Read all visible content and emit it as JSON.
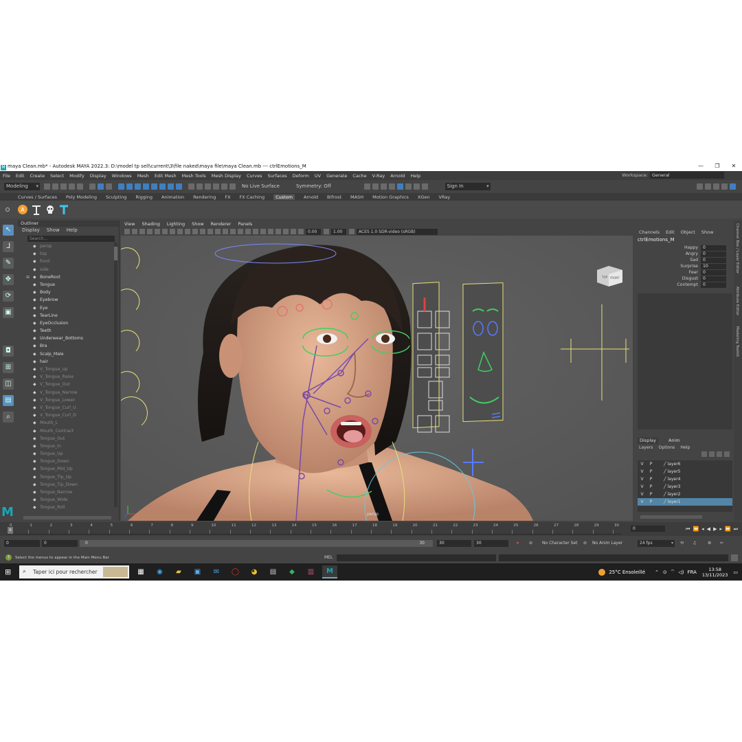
{
  "window": {
    "title": "maya Clean.mb* - Autodesk MAYA 2022.3: D:\\model tp sell\\current\\3\\file naked\\maya file\\maya Clean.mb  ---  ctrlEmotions_M",
    "logo_letter": "M",
    "minimize": "—",
    "maximize": "❐",
    "close": "✕"
  },
  "menubar": {
    "items": [
      "File",
      "Edit",
      "Create",
      "Select",
      "Modify",
      "Display",
      "Windows",
      "Mesh",
      "Edit Mesh",
      "Mesh Tools",
      "Mesh Display",
      "Curves",
      "Surfaces",
      "Deform",
      "UV",
      "Generate",
      "Cache",
      "V-Ray",
      "Arnold",
      "Help"
    ],
    "workspace_label": "Workspace:",
    "workspace_value": "General"
  },
  "statusline": {
    "mode": "Modeling",
    "live_surface": "No Live Surface",
    "symmetry": "Symmetry: Off",
    "sign_in": "Sign In"
  },
  "shelf": {
    "tabs": [
      "Curves / Surfaces",
      "Poly Modeling",
      "Sculpting",
      "Rigging",
      "Animation",
      "Rendering",
      "FX",
      "FX Caching",
      "Custom",
      "Arnold",
      "Bifrost",
      "MASH",
      "Motion Graphics",
      "XGen",
      "VRay"
    ],
    "active_tab": "Custom"
  },
  "outliner": {
    "title": "Outliner",
    "menu": [
      "Display",
      "Show",
      "Help"
    ],
    "search_placeholder": "Search...",
    "items": [
      {
        "label": "persp",
        "dim": true,
        "expander": ""
      },
      {
        "label": "top",
        "dim": true,
        "expander": ""
      },
      {
        "label": "front",
        "dim": true,
        "expander": ""
      },
      {
        "label": "side",
        "dim": true,
        "expander": ""
      },
      {
        "label": "BoneRoot",
        "dim": false,
        "expander": "⊞"
      },
      {
        "label": "Tongue",
        "dim": false,
        "expander": ""
      },
      {
        "label": "Body",
        "dim": false,
        "expander": ""
      },
      {
        "label": "Eyebrow",
        "dim": false,
        "expander": ""
      },
      {
        "label": "Eye",
        "dim": false,
        "expander": ""
      },
      {
        "label": "TearLine",
        "dim": false,
        "expander": ""
      },
      {
        "label": "EyeOcclusion",
        "dim": false,
        "expander": ""
      },
      {
        "label": "Teeth",
        "dim": false,
        "expander": ""
      },
      {
        "label": "Underwear_Bottoms",
        "dim": false,
        "expander": ""
      },
      {
        "label": "Bra",
        "dim": false,
        "expander": ""
      },
      {
        "label": "Scalp_Male",
        "dim": false,
        "expander": ""
      },
      {
        "label": "hair",
        "dim": false,
        "expander": ""
      },
      {
        "label": "V_Tongue_up",
        "dim": true,
        "expander": ""
      },
      {
        "label": "V_Tongue_Raise",
        "dim": true,
        "expander": ""
      },
      {
        "label": "V_Tongue_Out",
        "dim": true,
        "expander": ""
      },
      {
        "label": "V_Tongue_Narrow",
        "dim": true,
        "expander": ""
      },
      {
        "label": "V_Tongue_Lower",
        "dim": true,
        "expander": ""
      },
      {
        "label": "V_Tongue_Curl_U",
        "dim": true,
        "expander": ""
      },
      {
        "label": "V_Tongue_Curl_D",
        "dim": true,
        "expander": ""
      },
      {
        "label": "Mouth_L",
        "dim": true,
        "expander": ""
      },
      {
        "label": "Mouth_Contract",
        "dim": true,
        "expander": ""
      },
      {
        "label": "Tongue_Out",
        "dim": true,
        "expander": ""
      },
      {
        "label": "Tongue_In",
        "dim": true,
        "expander": ""
      },
      {
        "label": "Tongue_Up",
        "dim": true,
        "expander": ""
      },
      {
        "label": "Tongue_Down",
        "dim": true,
        "expander": ""
      },
      {
        "label": "Tongue_Mid_Up",
        "dim": true,
        "expander": ""
      },
      {
        "label": "Tongue_Tip_Up",
        "dim": true,
        "expander": ""
      },
      {
        "label": "Tongue_Tip_Down",
        "dim": true,
        "expander": ""
      },
      {
        "label": "Tongue_Narrow",
        "dim": true,
        "expander": ""
      },
      {
        "label": "Tongue_Wide",
        "dim": true,
        "expander": ""
      },
      {
        "label": "Tongue_Roll",
        "dim": true,
        "expander": ""
      }
    ]
  },
  "viewport": {
    "menu": [
      "View",
      "Shading",
      "Lighting",
      "Show",
      "Renderer",
      "Panels"
    ],
    "exposure": "0.00",
    "gamma": "1.00",
    "color_space": "ACES 1.0 SDR-video (sRGB)",
    "camera_label": "persp",
    "viewcube_left": "TOP",
    "viewcube_right": "FRONT"
  },
  "channel_box": {
    "menu": [
      "Channels",
      "Edit",
      "Object",
      "Show"
    ],
    "object": "ctrlEmotions_M",
    "attributes": [
      {
        "name": "Happy",
        "value": "0"
      },
      {
        "name": "Angry",
        "value": "0"
      },
      {
        "name": "Sad",
        "value": "0"
      },
      {
        "name": "Surprise",
        "value": "10"
      },
      {
        "name": "Fear",
        "value": "0"
      },
      {
        "name": "Disgust",
        "value": "0"
      },
      {
        "name": "Contempt",
        "value": "0"
      }
    ],
    "side_tabs": [
      "Channel Box / Layer Editor",
      "Attribute Editor",
      "Modeling Toolkit"
    ]
  },
  "layers": {
    "tabs": [
      "Display",
      "Anim"
    ],
    "menu": [
      "Layers",
      "Options",
      "Help"
    ],
    "rows": [
      {
        "v": "V",
        "p": "P",
        "name": "layer6",
        "selected": false
      },
      {
        "v": "V",
        "p": "P",
        "name": "layer5",
        "selected": false
      },
      {
        "v": "V",
        "p": "P",
        "name": "layer4",
        "selected": false
      },
      {
        "v": "V",
        "p": "P",
        "name": "layer3",
        "selected": false
      },
      {
        "v": "V",
        "p": "P",
        "name": "layer2",
        "selected": false
      },
      {
        "v": "V",
        "p": "P",
        "name": "layer1",
        "selected": true
      }
    ]
  },
  "timeline": {
    "ticks": [
      "0",
      "1",
      "2",
      "3",
      "4",
      "5",
      "6",
      "7",
      "8",
      "9",
      "10",
      "11",
      "12",
      "13",
      "14",
      "15",
      "16",
      "17",
      "18",
      "19",
      "20",
      "21",
      "22",
      "23",
      "24",
      "25",
      "26",
      "27",
      "28",
      "29",
      "30"
    ],
    "current_frame": "0",
    "current_frame_field": "0"
  },
  "range": {
    "start": "0",
    "anim_start": "0",
    "slider_start": "0",
    "slider_end": "30",
    "range_end": "30",
    "anim_end": "30",
    "character_set": "No Character Set",
    "anim_layer": "No Anim Layer",
    "fps": "24 fps"
  },
  "status": {
    "help_text": "Select the menus to appear in the Main Menu Bar",
    "mel_label": "MEL"
  },
  "taskbar": {
    "search_placeholder": "Taper ici pour rechercher",
    "weather": "25°C  Ensoleillé",
    "language": "FRA",
    "time": "13:58",
    "date": "13/11/2023"
  },
  "colors": {
    "accent": "#5285a6",
    "maya_teal": "#1aa6b7",
    "wire_yellow": "#e8e07a",
    "wire_purple": "#7a4aa8",
    "wire_green": "#40d060"
  }
}
